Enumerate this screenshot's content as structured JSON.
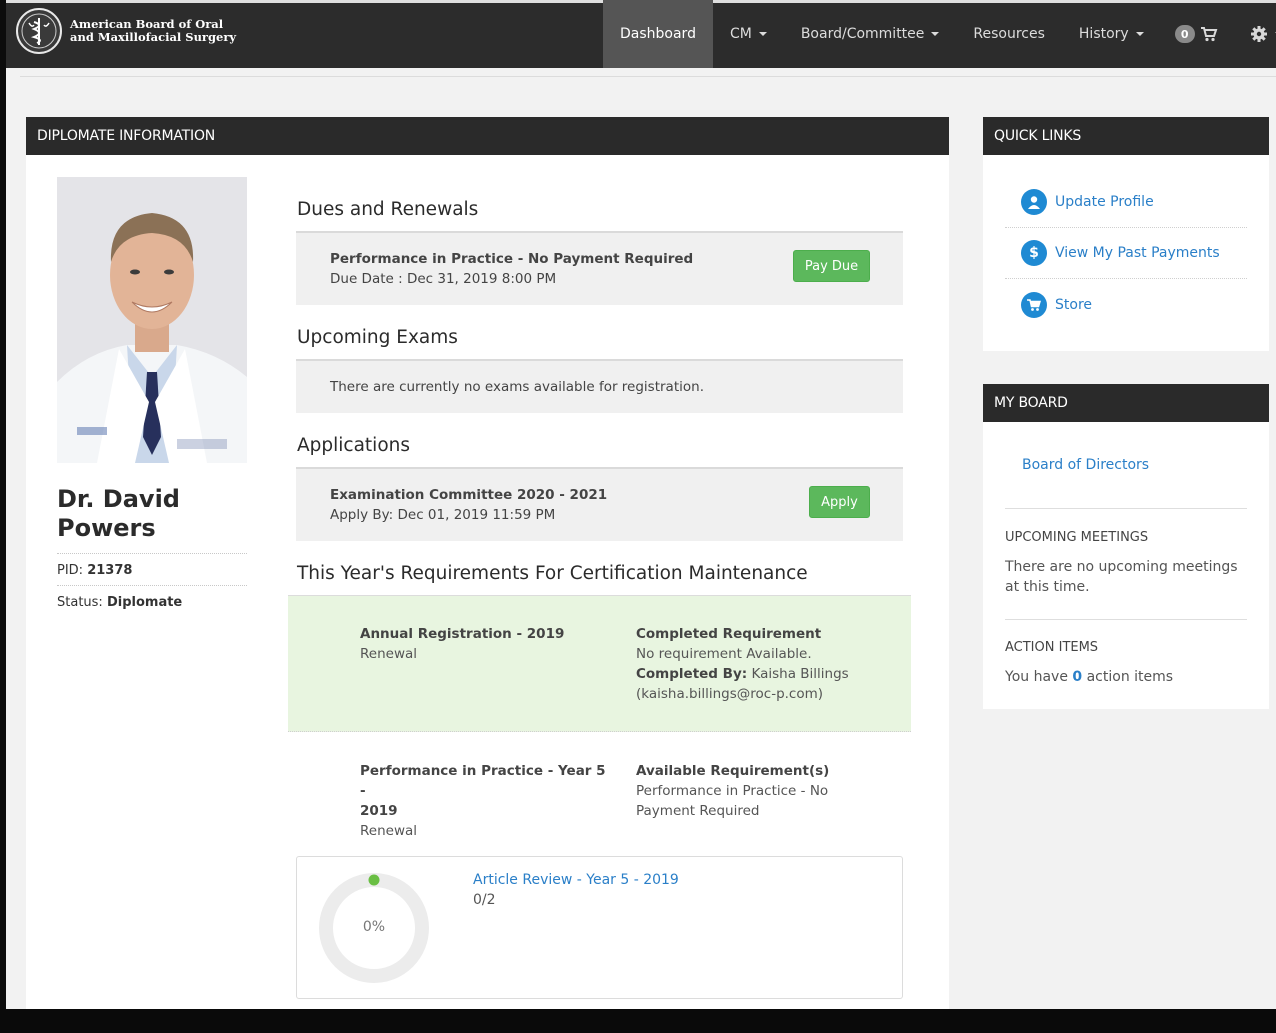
{
  "brand": {
    "line1": "American Board of Oral",
    "line2": "and Maxillofacial Surgery",
    "logo_icon": "staff-of-asclepius-seal"
  },
  "nav": {
    "dashboard": "Dashboard",
    "cm": "CM",
    "board_committee": "Board/Committee",
    "resources": "Resources",
    "history": "History",
    "cart_count": "0",
    "cart_icon": "cart-icon",
    "settings_icon": "gear-icon"
  },
  "diplomate": {
    "header": "DIPLOMATE INFORMATION",
    "name": "Dr. David Powers",
    "pid_label": "PID:",
    "pid": "21378",
    "status_label": "Status:",
    "status": "Diplomate"
  },
  "dues": {
    "title": "Dues and Renewals",
    "item_title": "Performance in Practice - No Payment Required",
    "item_due": "Due Date : Dec 31, 2019 8:00 PM",
    "button": "Pay Due"
  },
  "exams": {
    "title": "Upcoming Exams",
    "message": "There are currently no exams available for registration."
  },
  "applications": {
    "title": "Applications",
    "item_title": "Examination Committee 2020 - 2021",
    "item_apply_by": "Apply By: Dec 01, 2019 11:59 PM",
    "button": "Apply"
  },
  "requirements": {
    "title": "This Year's Requirements For Certification Maintenance",
    "annual": {
      "name": "Annual Registration - 2019",
      "type": "Renewal",
      "status_title": "Completed Requirement",
      "status_text": "No requirement Available.",
      "completed_by_label": "Completed By:",
      "completed_by_name": "Kaisha Billings",
      "completed_by_email": "(kaisha.billings@roc-p.com)"
    },
    "pip": {
      "name_line1": "Performance in Practice - Year 5 -",
      "name_line2": "2019",
      "type": "Renewal",
      "status_title": "Available Requirement(s)",
      "status_line1": "Performance in Practice - No",
      "status_line2": "Payment Required"
    },
    "article": {
      "link": "Article Review - Year 5 - 2019",
      "count": "0/2",
      "percent_label": "0%",
      "progress": 0
    }
  },
  "quick_links": {
    "header": "QUICK LINKS",
    "items": [
      {
        "label": "Update Profile",
        "icon": "user-icon"
      },
      {
        "label": "View My Past Payments",
        "icon": "dollar-icon"
      },
      {
        "label": "Store",
        "icon": "cart-icon"
      }
    ]
  },
  "my_board": {
    "header": "MY BOARD",
    "link": "Board of Directors",
    "meetings_head": "UPCOMING MEETINGS",
    "meetings_text": "There are no upcoming meetings at this time.",
    "actions_head": "ACTION ITEMS",
    "actions_prefix": "You have",
    "actions_count": "0",
    "actions_suffix": "action items"
  },
  "colors": {
    "navbar": "#2c2c2c",
    "accent_green": "#5cb85c",
    "link_blue": "#2a7fc8",
    "panel_header": "#2a2a2a",
    "completed_bg": "#e8f5e0"
  }
}
